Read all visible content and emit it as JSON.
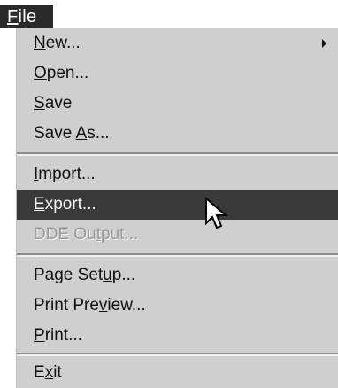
{
  "menubar": {
    "file_menu": {
      "pre": "",
      "key": "F",
      "post": "ile"
    }
  },
  "menu": {
    "items": [
      {
        "pre": "",
        "key": "N",
        "post": "ew...",
        "has_submenu": true
      },
      {
        "pre": "",
        "key": "O",
        "post": "pen..."
      },
      {
        "pre": "",
        "key": "S",
        "post": "ave"
      },
      {
        "pre": "Save ",
        "key": "A",
        "post": "s..."
      },
      {
        "pre": "",
        "key": "I",
        "post": "mport..."
      },
      {
        "pre": "",
        "key": "E",
        "post": "xport...",
        "state": "highlighted"
      },
      {
        "pre": "DDE Ou",
        "key": "t",
        "post": "put...",
        "state": "disabled"
      },
      {
        "pre": "Page Set",
        "key": "u",
        "post": "p..."
      },
      {
        "pre": "Print Pre",
        "key": "v",
        "post": "iew..."
      },
      {
        "pre": "",
        "key": "P",
        "post": "rint..."
      },
      {
        "pre": "E",
        "key": "x",
        "post": "it"
      }
    ]
  },
  "colors": {
    "menu_background": "#cfcfcf",
    "highlight_background": "#3a3a3a",
    "menubar_background": "#2a2a2a",
    "disabled_text": "#9a9a9a"
  },
  "icons": {
    "submenu": "chevron-right-icon",
    "pointer": "mouse-cursor-icon"
  }
}
